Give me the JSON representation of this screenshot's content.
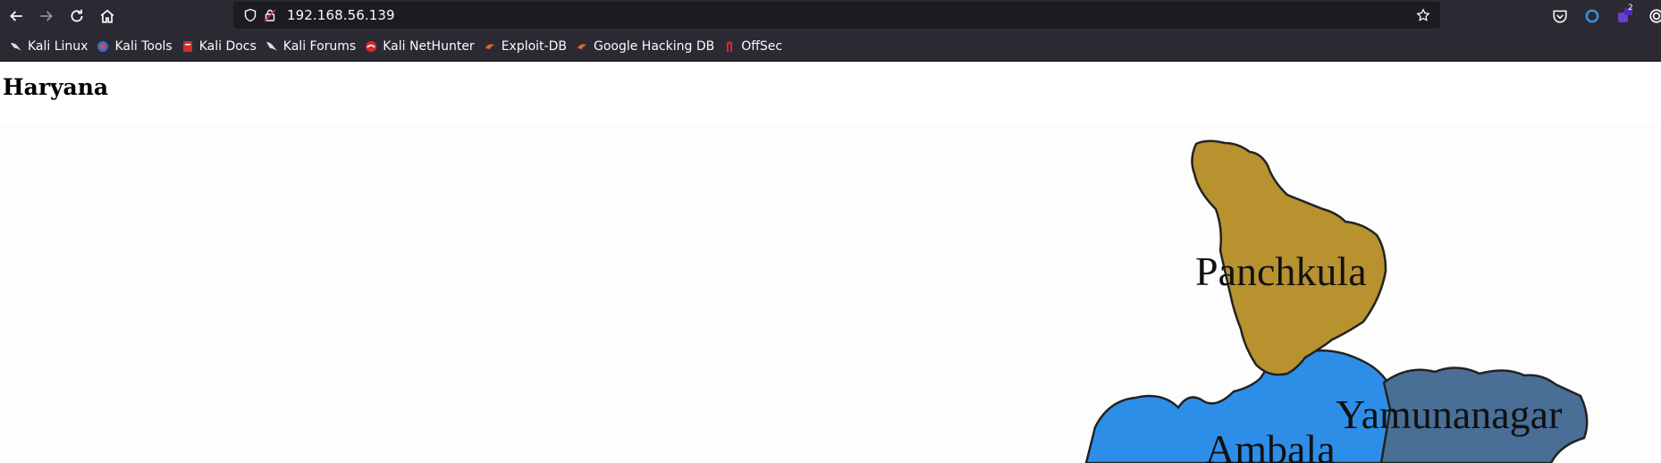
{
  "browser": {
    "url": "192.168.56.139",
    "nav": {
      "back": "back-arrow",
      "forward": "forward-arrow",
      "reload": "reload",
      "home": "home"
    },
    "extension_badge": "2"
  },
  "bookmarks": [
    {
      "label": "Kali Linux",
      "icon": "kali-dragon-icon",
      "color": "#2b2a33"
    },
    {
      "label": "Kali Tools",
      "icon": "kali-tools-icon",
      "color": "#2f6fd8"
    },
    {
      "label": "Kali Docs",
      "icon": "kali-docs-icon",
      "color": "#d62b2b"
    },
    {
      "label": "Kali Forums",
      "icon": "kali-forums-icon",
      "color": "#2b2a33"
    },
    {
      "label": "Kali NetHunter",
      "icon": "nethunter-icon",
      "color": "#d62b2b"
    },
    {
      "label": "Exploit-DB",
      "icon": "exploit-db-icon",
      "color": "#e8622a"
    },
    {
      "label": "Google Hacking DB",
      "icon": "ghdb-icon",
      "color": "#e8622a"
    },
    {
      "label": "OffSec",
      "icon": "offsec-icon",
      "color": "#d62b2b"
    }
  ],
  "page": {
    "heading": "Haryana",
    "map": {
      "regions": [
        {
          "name": "Panchkula",
          "color": "#b8922f"
        },
        {
          "name": "Yamunanagar",
          "color": "#4a6f96"
        },
        {
          "name": "Ambala",
          "color": "#2d8ee8"
        }
      ]
    }
  }
}
